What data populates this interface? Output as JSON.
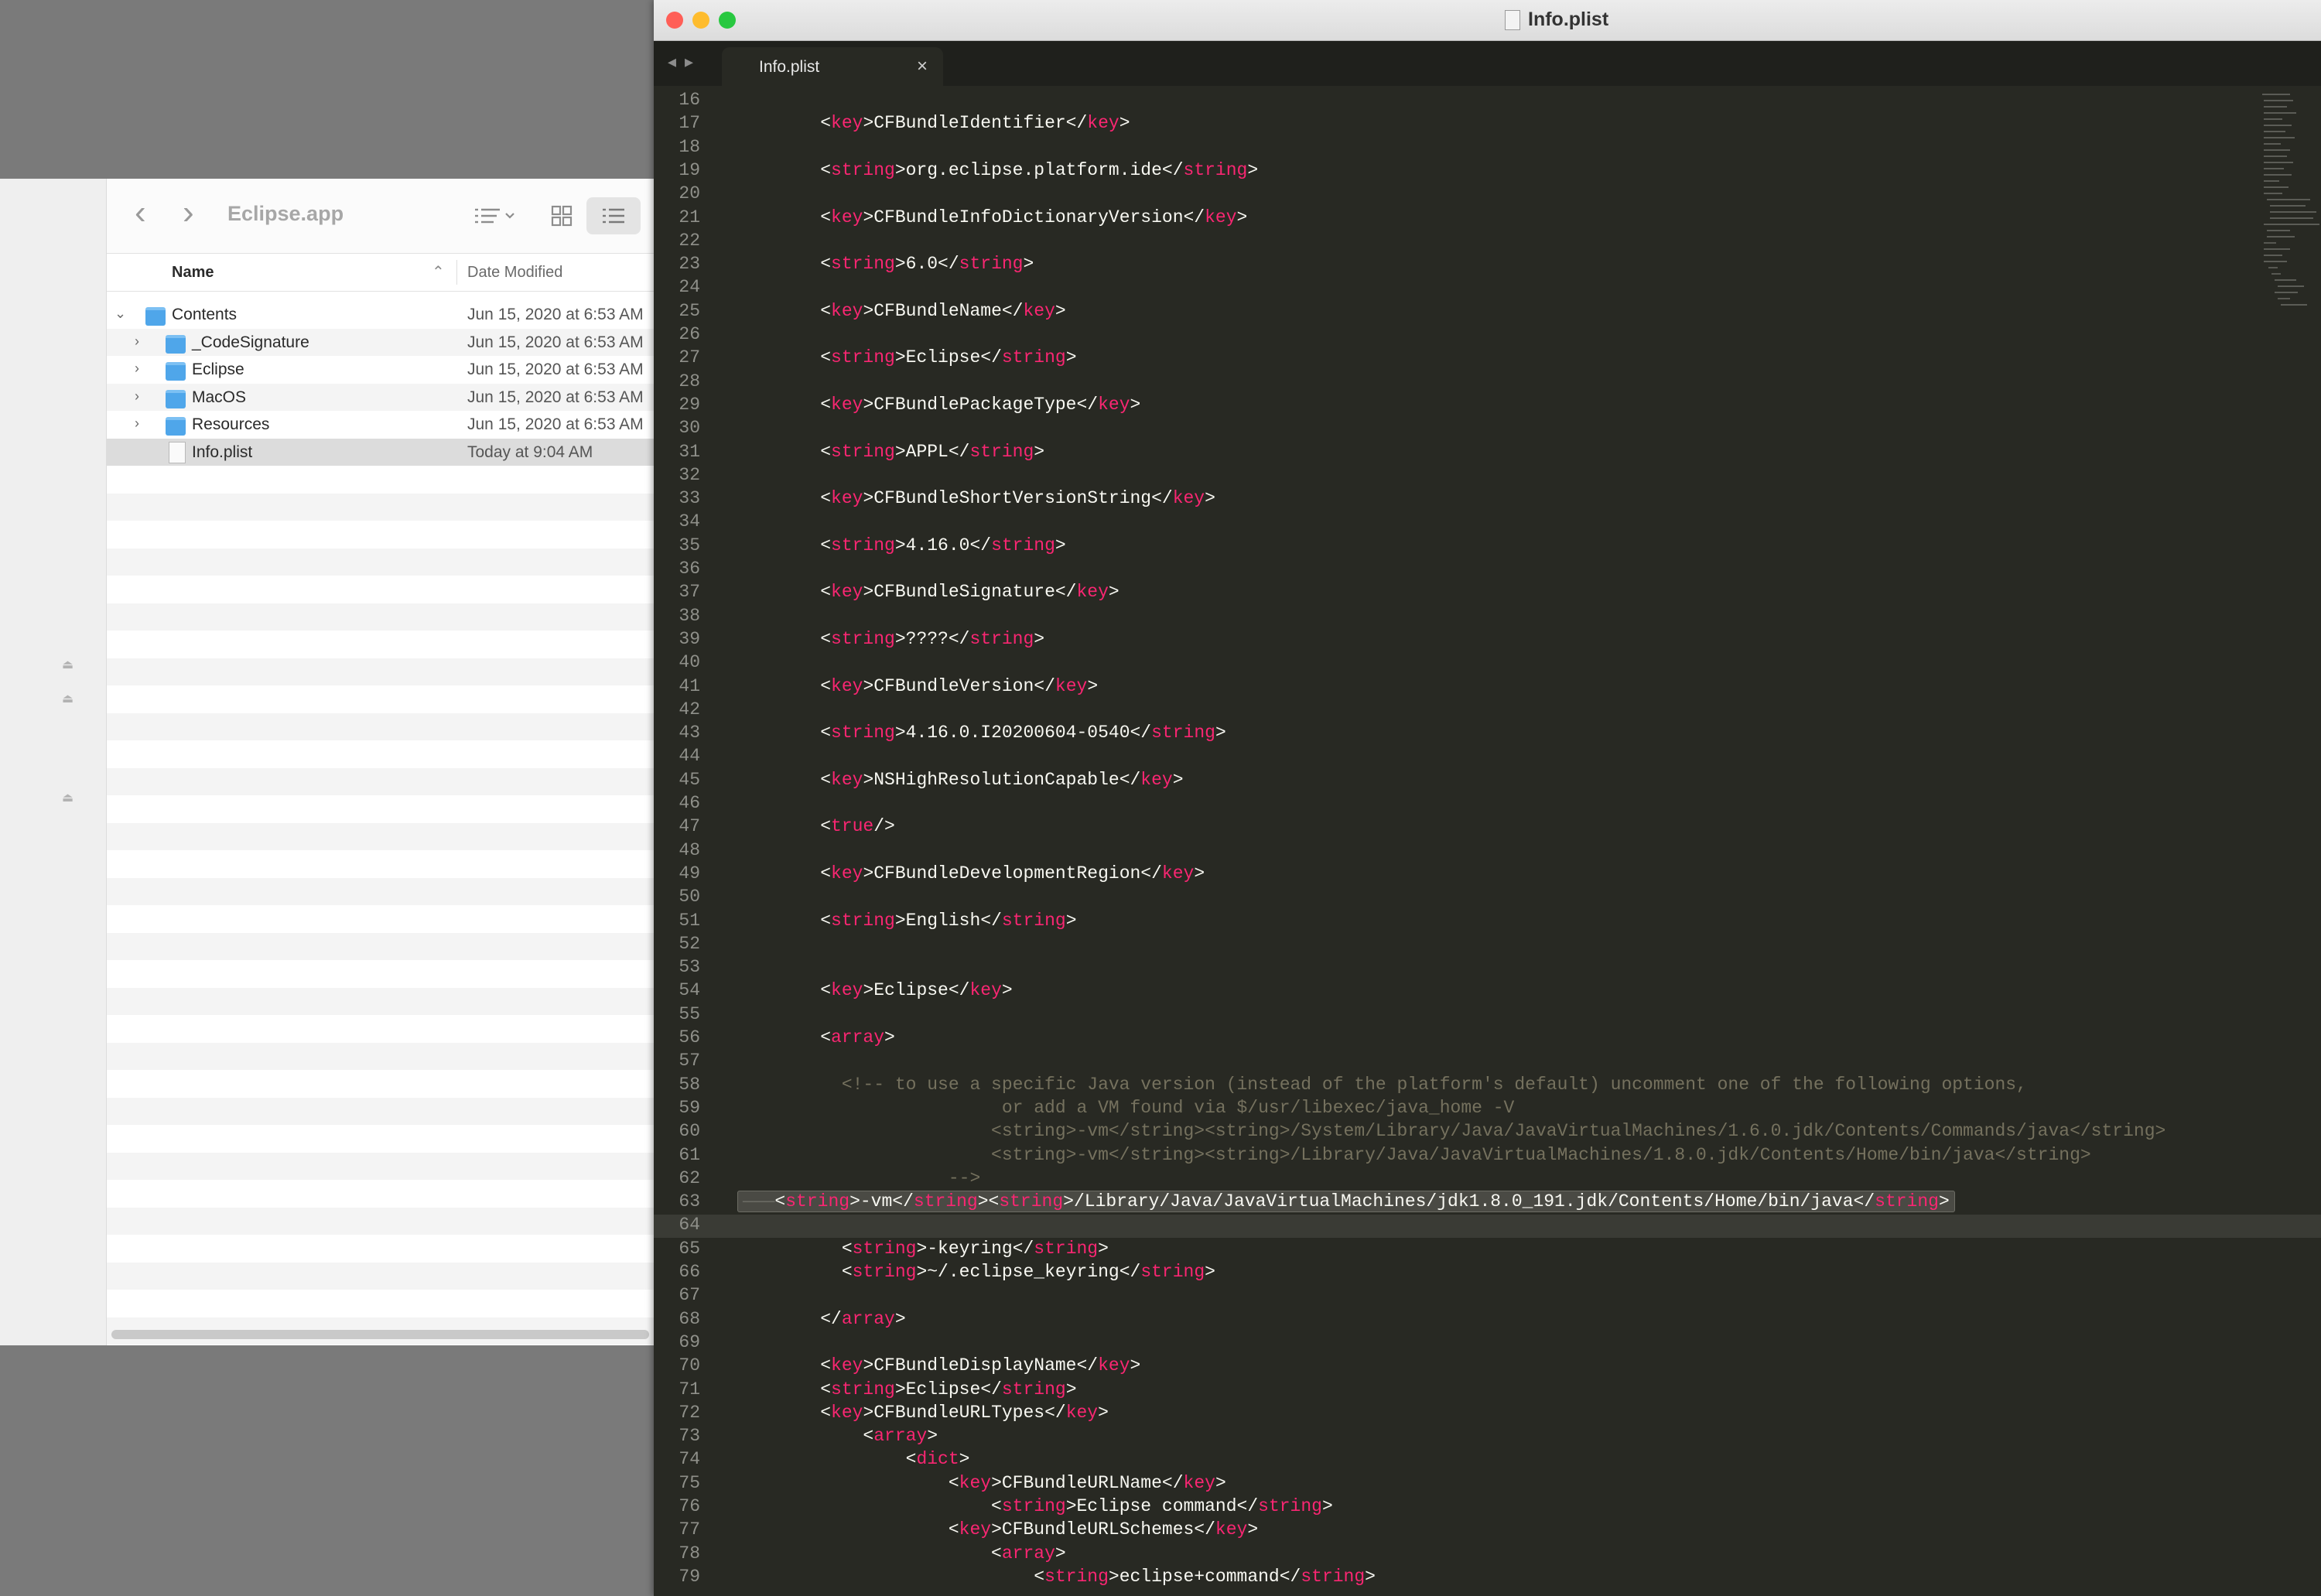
{
  "finder": {
    "title": "Eclipse.app",
    "columns": {
      "name": "Name",
      "date": "Date Modified"
    },
    "rows": [
      {
        "name": "Contents",
        "date": "Jun 15, 2020 at 6:53 AM",
        "type": "folder",
        "expanded": true,
        "indent": 0
      },
      {
        "name": "_CodeSignature",
        "date": "Jun 15, 2020 at 6:53 AM",
        "type": "folder",
        "expanded": false,
        "indent": 1
      },
      {
        "name": "Eclipse",
        "date": "Jun 15, 2020 at 6:53 AM",
        "type": "folder",
        "expanded": false,
        "indent": 1
      },
      {
        "name": "MacOS",
        "date": "Jun 15, 2020 at 6:53 AM",
        "type": "folder",
        "expanded": false,
        "indent": 1
      },
      {
        "name": "Resources",
        "date": "Jun 15, 2020 at 6:53 AM",
        "type": "folder",
        "expanded": false,
        "indent": 1
      },
      {
        "name": "Info.plist",
        "date": "Today at 9:04 AM",
        "type": "file",
        "selected": true,
        "indent": 1
      }
    ]
  },
  "editor": {
    "window_title": "Info.plist",
    "tab_label": "Info.plist",
    "current_line": 64,
    "lines": [
      {
        "n": "16",
        "parts": []
      },
      {
        "n": "17",
        "parts": [
          [
            "p",
            "\t<"
          ],
          [
            "t",
            "key"
          ],
          [
            "p",
            ">CFBundleIdentifier</"
          ],
          [
            "t",
            "key"
          ],
          [
            "p",
            ">"
          ]
        ]
      },
      {
        "n": "18",
        "parts": []
      },
      {
        "n": "19",
        "parts": [
          [
            "p",
            "\t<"
          ],
          [
            "t",
            "string"
          ],
          [
            "p",
            ">org.eclipse.platform.ide</"
          ],
          [
            "t",
            "string"
          ],
          [
            "p",
            ">"
          ]
        ]
      },
      {
        "n": "20",
        "parts": []
      },
      {
        "n": "21",
        "parts": [
          [
            "p",
            "\t<"
          ],
          [
            "t",
            "key"
          ],
          [
            "p",
            ">CFBundleInfoDictionaryVersion</"
          ],
          [
            "t",
            "key"
          ],
          [
            "p",
            ">"
          ]
        ]
      },
      {
        "n": "22",
        "parts": []
      },
      {
        "n": "23",
        "parts": [
          [
            "p",
            "\t<"
          ],
          [
            "t",
            "string"
          ],
          [
            "p",
            ">6.0</"
          ],
          [
            "t",
            "string"
          ],
          [
            "p",
            ">"
          ]
        ]
      },
      {
        "n": "24",
        "parts": []
      },
      {
        "n": "25",
        "parts": [
          [
            "p",
            "\t<"
          ],
          [
            "t",
            "key"
          ],
          [
            "p",
            ">CFBundleName</"
          ],
          [
            "t",
            "key"
          ],
          [
            "p",
            ">"
          ]
        ]
      },
      {
        "n": "26",
        "parts": []
      },
      {
        "n": "27",
        "parts": [
          [
            "p",
            "\t<"
          ],
          [
            "t",
            "string"
          ],
          [
            "p",
            ">Eclipse</"
          ],
          [
            "t",
            "string"
          ],
          [
            "p",
            ">"
          ]
        ]
      },
      {
        "n": "28",
        "parts": []
      },
      {
        "n": "29",
        "parts": [
          [
            "p",
            "\t<"
          ],
          [
            "t",
            "key"
          ],
          [
            "p",
            ">CFBundlePackageType</"
          ],
          [
            "t",
            "key"
          ],
          [
            "p",
            ">"
          ]
        ]
      },
      {
        "n": "30",
        "parts": []
      },
      {
        "n": "31",
        "parts": [
          [
            "p",
            "\t<"
          ],
          [
            "t",
            "string"
          ],
          [
            "p",
            ">APPL</"
          ],
          [
            "t",
            "string"
          ],
          [
            "p",
            ">"
          ]
        ]
      },
      {
        "n": "32",
        "parts": []
      },
      {
        "n": "33",
        "parts": [
          [
            "p",
            "\t<"
          ],
          [
            "t",
            "key"
          ],
          [
            "p",
            ">CFBundleShortVersionString</"
          ],
          [
            "t",
            "key"
          ],
          [
            "p",
            ">"
          ]
        ]
      },
      {
        "n": "34",
        "parts": []
      },
      {
        "n": "35",
        "parts": [
          [
            "p",
            "\t<"
          ],
          [
            "t",
            "string"
          ],
          [
            "p",
            ">4.16.0</"
          ],
          [
            "t",
            "string"
          ],
          [
            "p",
            ">"
          ]
        ]
      },
      {
        "n": "36",
        "parts": []
      },
      {
        "n": "37",
        "parts": [
          [
            "p",
            "\t<"
          ],
          [
            "t",
            "key"
          ],
          [
            "p",
            ">CFBundleSignature</"
          ],
          [
            "t",
            "key"
          ],
          [
            "p",
            ">"
          ]
        ]
      },
      {
        "n": "38",
        "parts": []
      },
      {
        "n": "39",
        "parts": [
          [
            "p",
            "\t<"
          ],
          [
            "t",
            "string"
          ],
          [
            "p",
            ">????</"
          ],
          [
            "t",
            "string"
          ],
          [
            "p",
            ">"
          ]
        ]
      },
      {
        "n": "40",
        "parts": []
      },
      {
        "n": "41",
        "parts": [
          [
            "p",
            "\t<"
          ],
          [
            "t",
            "key"
          ],
          [
            "p",
            ">CFBundleVersion</"
          ],
          [
            "t",
            "key"
          ],
          [
            "p",
            ">"
          ]
        ]
      },
      {
        "n": "42",
        "parts": []
      },
      {
        "n": "43",
        "parts": [
          [
            "p",
            "\t<"
          ],
          [
            "t",
            "string"
          ],
          [
            "p",
            ">4.16.0.I20200604-0540</"
          ],
          [
            "t",
            "string"
          ],
          [
            "p",
            ">"
          ]
        ]
      },
      {
        "n": "44",
        "parts": []
      },
      {
        "n": "45",
        "parts": [
          [
            "p",
            "\t<"
          ],
          [
            "t",
            "key"
          ],
          [
            "p",
            ">NSHighResolutionCapable</"
          ],
          [
            "t",
            "key"
          ],
          [
            "p",
            ">"
          ]
        ]
      },
      {
        "n": "46",
        "parts": []
      },
      {
        "n": "47",
        "parts": [
          [
            "p",
            "\t<"
          ],
          [
            "t",
            "true"
          ],
          [
            "p",
            "/>"
          ]
        ]
      },
      {
        "n": "48",
        "parts": []
      },
      {
        "n": "49",
        "parts": [
          [
            "p",
            "\t<"
          ],
          [
            "t",
            "key"
          ],
          [
            "p",
            ">CFBundleDevelopmentRegion</"
          ],
          [
            "t",
            "key"
          ],
          [
            "p",
            ">"
          ]
        ]
      },
      {
        "n": "50",
        "parts": []
      },
      {
        "n": "51",
        "parts": [
          [
            "p",
            "\t<"
          ],
          [
            "t",
            "string"
          ],
          [
            "p",
            ">English</"
          ],
          [
            "t",
            "string"
          ],
          [
            "p",
            ">"
          ]
        ]
      },
      {
        "n": "52",
        "parts": []
      },
      {
        "n": "53",
        "parts": []
      },
      {
        "n": "54",
        "parts": [
          [
            "p",
            "\t<"
          ],
          [
            "t",
            "key"
          ],
          [
            "p",
            ">Eclipse</"
          ],
          [
            "t",
            "key"
          ],
          [
            "p",
            ">"
          ]
        ]
      },
      {
        "n": "55",
        "parts": []
      },
      {
        "n": "56",
        "parts": [
          [
            "p",
            "\t<"
          ],
          [
            "t",
            "array"
          ],
          [
            "p",
            ">"
          ]
        ]
      },
      {
        "n": "57",
        "parts": []
      },
      {
        "n": "58",
        "parts": [
          [
            "c",
            "\t  <!-- to use a specific Java version (instead of the platform's default) uncomment one of the following options,"
          ]
        ]
      },
      {
        "n": "59",
        "parts": [
          [
            "c",
            "\t\t\t\t\t or add a VM found via $/usr/libexec/java_home -V"
          ]
        ]
      },
      {
        "n": "60",
        "parts": [
          [
            "c",
            "\t\t\t\t\t<string>-vm</string><string>/System/Library/Java/JavaVirtualMachines/1.6.0.jdk/Contents/Commands/java</string>"
          ]
        ]
      },
      {
        "n": "61",
        "parts": [
          [
            "c",
            "\t\t\t\t\t<string>-vm</string><string>/Library/Java/JavaVirtualMachines/1.8.0.jdk/Contents/Home/bin/java</string>"
          ]
        ]
      },
      {
        "n": "62",
        "parts": [
          [
            "c",
            "\t\t\t\t-->"
          ]
        ]
      },
      {
        "n": "63",
        "highlight": true,
        "parts": [
          [
            "p",
            "<"
          ],
          [
            "t",
            "string"
          ],
          [
            "p",
            ">-vm</"
          ],
          [
            "t",
            "string"
          ],
          [
            "p",
            "><"
          ],
          [
            "t",
            "string"
          ],
          [
            "p",
            ">/Library/Java/JavaVirtualMachines/jdk1.8.0_191.jdk/Contents/Home/bin/java</"
          ],
          [
            "t",
            "string"
          ],
          [
            "p",
            ">"
          ]
        ]
      },
      {
        "n": "64",
        "parts": []
      },
      {
        "n": "65",
        "parts": [
          [
            "p",
            "\t  <"
          ],
          [
            "t",
            "string"
          ],
          [
            "p",
            ">-keyring</"
          ],
          [
            "t",
            "string"
          ],
          [
            "p",
            ">"
          ]
        ]
      },
      {
        "n": "66",
        "parts": [
          [
            "p",
            "\t  <"
          ],
          [
            "t",
            "string"
          ],
          [
            "p",
            ">~/.eclipse_keyring</"
          ],
          [
            "t",
            "string"
          ],
          [
            "p",
            ">"
          ]
        ]
      },
      {
        "n": "67",
        "parts": []
      },
      {
        "n": "68",
        "parts": [
          [
            "p",
            "\t</"
          ],
          [
            "t",
            "array"
          ],
          [
            "p",
            ">"
          ]
        ]
      },
      {
        "n": "69",
        "parts": []
      },
      {
        "n": "70",
        "parts": [
          [
            "p",
            "\t<"
          ],
          [
            "t",
            "key"
          ],
          [
            "p",
            ">CFBundleDisplayName</"
          ],
          [
            "t",
            "key"
          ],
          [
            "p",
            ">"
          ]
        ]
      },
      {
        "n": "71",
        "parts": [
          [
            "p",
            "\t<"
          ],
          [
            "t",
            "string"
          ],
          [
            "p",
            ">Eclipse</"
          ],
          [
            "t",
            "string"
          ],
          [
            "p",
            ">"
          ]
        ]
      },
      {
        "n": "72",
        "parts": [
          [
            "p",
            "\t<"
          ],
          [
            "t",
            "key"
          ],
          [
            "p",
            ">CFBundleURLTypes</"
          ],
          [
            "t",
            "key"
          ],
          [
            "p",
            ">"
          ]
        ]
      },
      {
        "n": "73",
        "parts": [
          [
            "p",
            "\t\t<"
          ],
          [
            "t",
            "array"
          ],
          [
            "p",
            ">"
          ]
        ]
      },
      {
        "n": "74",
        "parts": [
          [
            "p",
            "\t\t\t<"
          ],
          [
            "t",
            "dict"
          ],
          [
            "p",
            ">"
          ]
        ]
      },
      {
        "n": "75",
        "parts": [
          [
            "p",
            "\t\t\t\t<"
          ],
          [
            "t",
            "key"
          ],
          [
            "p",
            ">CFBundleURLName</"
          ],
          [
            "t",
            "key"
          ],
          [
            "p",
            ">"
          ]
        ]
      },
      {
        "n": "76",
        "parts": [
          [
            "p",
            "\t\t\t\t\t<"
          ],
          [
            "t",
            "string"
          ],
          [
            "p",
            ">Eclipse command</"
          ],
          [
            "t",
            "string"
          ],
          [
            "p",
            ">"
          ]
        ]
      },
      {
        "n": "77",
        "parts": [
          [
            "p",
            "\t\t\t\t<"
          ],
          [
            "t",
            "key"
          ],
          [
            "p",
            ">CFBundleURLSchemes</"
          ],
          [
            "t",
            "key"
          ],
          [
            "p",
            ">"
          ]
        ]
      },
      {
        "n": "78",
        "parts": [
          [
            "p",
            "\t\t\t\t\t<"
          ],
          [
            "t",
            "array"
          ],
          [
            "p",
            ">"
          ]
        ]
      },
      {
        "n": "79",
        "parts": [
          [
            "p",
            "\t\t\t\t\t\t<"
          ],
          [
            "t",
            "string"
          ],
          [
            "p",
            ">eclipse+command</"
          ],
          [
            "t",
            "string"
          ],
          [
            "p",
            ">"
          ]
        ]
      }
    ]
  },
  "colors": {
    "editor_bg": "#282923",
    "tag": "#f92672",
    "text": "#f8f8f2",
    "comment": "#75715e",
    "folder": "#4fa6ea",
    "close": "#ff5f57",
    "minimize": "#febc2e",
    "zoom": "#28c840"
  },
  "icons": [
    "back-chevron-icon",
    "forward-chevron-icon",
    "list-view-icon",
    "grid-view-icon",
    "folder-icon",
    "document-icon",
    "eject-icon",
    "close-icon"
  ]
}
